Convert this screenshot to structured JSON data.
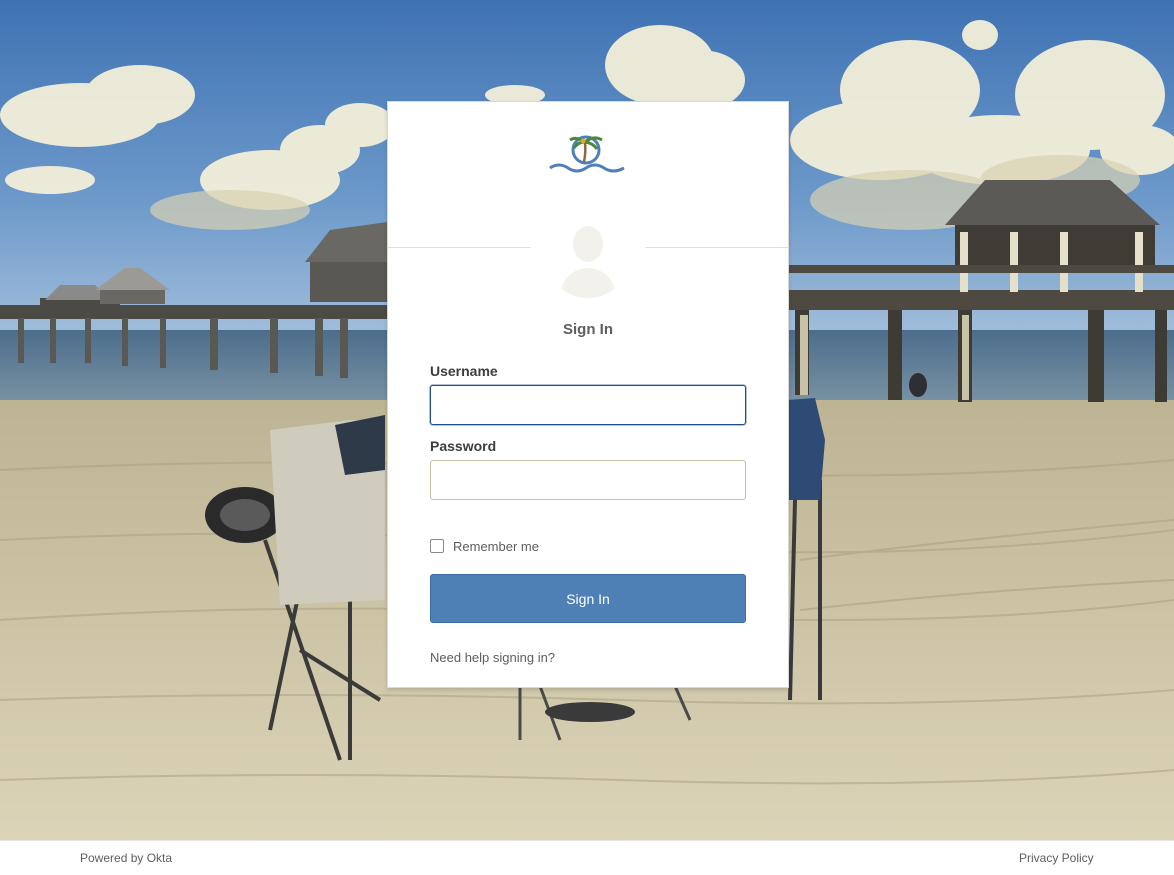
{
  "login": {
    "title": "Sign In",
    "username_label": "Username",
    "username_value": "",
    "password_label": "Password",
    "password_value": "",
    "remember_label": "Remember me",
    "remember_checked": false,
    "submit_label": "Sign In",
    "help_link": "Need help signing in?"
  },
  "footer": {
    "powered_by": "Powered by Okta",
    "privacy_link": "Privacy Policy"
  },
  "colors": {
    "primary_button": "#4e80b5",
    "focus_border": "#1f4f86"
  },
  "icons": {
    "logo": "palm-tree-wave-logo",
    "avatar": "user-silhouette-icon"
  }
}
